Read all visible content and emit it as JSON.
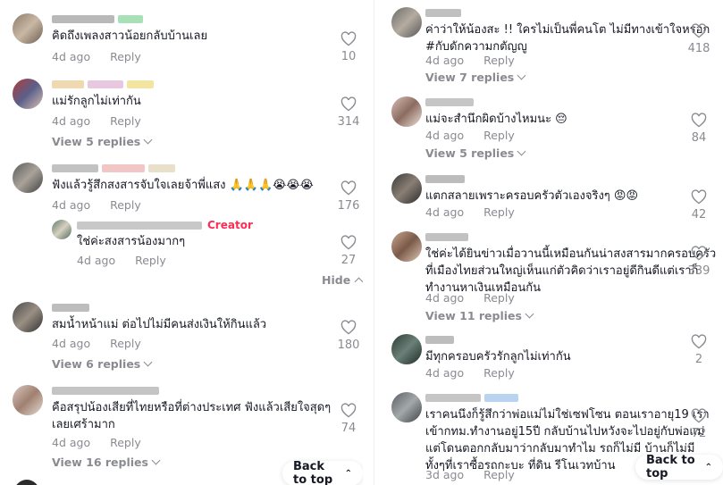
{
  "common": {
    "reply_label": "Reply",
    "back_to_top": "Back to top",
    "hide_label": "Hide",
    "creator_badge": "Creator"
  },
  "left": {
    "c1": {
      "text": "คิดถึงเพลงสาวน้อยกลับบ้านเลย",
      "age": "4d ago",
      "likes": "10"
    },
    "c2": {
      "text": "แม่รักลูกไม่เท่ากัน",
      "age": "4d ago",
      "likes": "314",
      "view_replies": "View 5 replies"
    },
    "c3": {
      "text": "ฟังแล้วรู้สึกสงสารจับใจเลยจ้าพี่แสง 🙏🙏🙏😭😭😭",
      "age": "4d ago",
      "likes": "176"
    },
    "c3r": {
      "text": "ใช่ค่ะสงสารน้องมากๆ",
      "age": "4d ago",
      "likes": "27"
    },
    "c4": {
      "text": "สมน้ำหน้าแม่ ต่อไปไม่มีคนส่งเงินให้กินแล้ว",
      "age": "4d ago",
      "likes": "180",
      "view_replies": "View 6 replies"
    },
    "c5": {
      "line1": "คือสรุปน้องเสียที่ไทยหรือที่ต่างประเทศ ฟังแล้วเสียใจสุดๆ",
      "line2": "เลยเศร้ามาก",
      "age": "4d ago",
      "likes": "74",
      "view_replies": "View 16 replies"
    }
  },
  "right": {
    "c1": {
      "line1": "ค่าว่าให้น้องสะ !! ใครไม่เป็นพี่คนโต ไม่มีทางเข้าใจหรอก",
      "line2": "#กับดักความกตัญญู",
      "age": "4d ago",
      "likes": "418",
      "view_replies": "View 7 replies"
    },
    "c2": {
      "text": "แม่จะสำนึกผิดบ้างไหมนะ 😔",
      "age": "4d ago",
      "likes": "84",
      "view_replies": "View 5 replies"
    },
    "c3": {
      "text": "แตกสลายเพราะครอบครัวตัวเองจริงๆ 😡😡",
      "age": "4d ago",
      "likes": "42"
    },
    "c4": {
      "line1": "ใช่ค่ะได้ยินข่าวเมื่อวานนี้เหมือนกันน่าสงสารมากครอบครัว",
      "line2": "ที่เมืองไทยส่วนใหญ่เห็นแก่ตัวคิดว่าเราอยู่ดีกินดีแต่เราก็",
      "line3": "ทำงานหาเงินเหมือนกัน",
      "age": "4d ago",
      "likes": "339",
      "view_replies": "View 11 replies"
    },
    "c5": {
      "text": "มีทุกครอบครัวรักลูกไม่เท่ากัน",
      "age": "4d ago",
      "likes": "2"
    },
    "c6": {
      "line1": "เราคนนึงก็รู้สึกว่าพ่อแม่ไม่ใช่เซฟโซน ตอนเราอายุ19 เรา",
      "line2": "เข้ากทม.ทำงานอยู่15ปี กลับบ้านไปหวังจะไปอยู่กับพ่อแม่",
      "line3": "แต่โดนตอกกลับมาว่ากลับมาทำไม รถก็ไม่มี บ้านก็ไม่มี",
      "line4": "ทั้งๆที่เราซื้อรถกะบะ ที่ดิน รีโนเวทบ้าน",
      "age": "3d ago",
      "likes": "72"
    }
  }
}
